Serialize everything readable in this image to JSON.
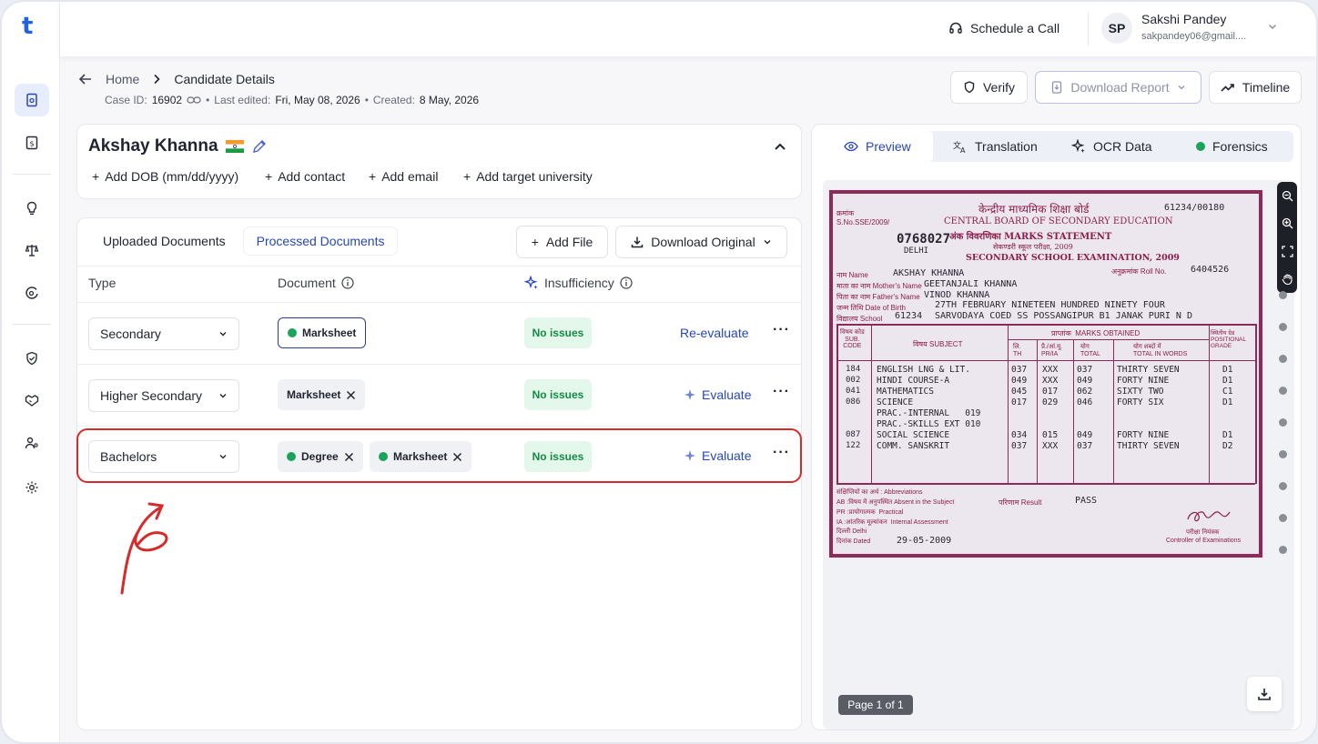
{
  "app": {
    "logo": "t"
  },
  "topbar": {
    "schedule_label": "Schedule a Call",
    "user": {
      "initials": "SP",
      "name": "Sakshi Pandey",
      "email": "sakpandey06@gmail...."
    }
  },
  "breadcrumb": {
    "home": "Home",
    "current": "Candidate Details"
  },
  "meta": {
    "case_label": "Case ID:",
    "case_id": "16902",
    "edited_label": "Last edited:",
    "edited": "Fri, May 08, 2026",
    "created_label": "Created:",
    "created": "8 May, 2026"
  },
  "header_actions": {
    "verify": "Verify",
    "download_report": "Download Report",
    "timeline": "Timeline"
  },
  "candidate": {
    "name": "Akshay Khanna",
    "add_dob": "Add DOB (mm/dd/yyyy)",
    "add_contact": "Add contact",
    "add_email": "Add email",
    "add_university": "Add target university"
  },
  "documents": {
    "tabs": [
      "Uploaded Documents",
      "Processed Documents"
    ],
    "add_file": "Add File",
    "download_original": "Download Original",
    "columns": {
      "type": "Type",
      "document": "Document",
      "insufficiency": "Insufficiency"
    },
    "rows": [
      {
        "type": "Secondary",
        "chips": [
          "Marksheet"
        ],
        "status": "No issues",
        "action": "Re-evaluate"
      },
      {
        "type": "Higher Secondary",
        "chips": [
          "Marksheet"
        ],
        "status": "No issues",
        "action": "Evaluate"
      },
      {
        "type": "Bachelors",
        "chips": [
          "Degree",
          "Marksheet"
        ],
        "status": "No issues",
        "action": "Evaluate"
      }
    ]
  },
  "preview": {
    "tabs": [
      "Preview",
      "Translation",
      "OCR Data",
      "Forensics"
    ],
    "page_indicator": "Page 1 of 1"
  },
  "marksheet": {
    "serial_hi": "क्रमांक",
    "serial": "S.No.SSE/2009/",
    "number": "0768027",
    "city": "DELHI",
    "code": "61234/00180",
    "board_hi": "केन्द्रीय माध्यमिक शिक्षा बोर्ड",
    "board": "CENTRAL BOARD OF SECONDARY EDUCATION",
    "statement_hi": "अंक विवरणिका MARKS STATEMENT",
    "exam_hi": "सेकण्डरी स्कूल परीक्षा, 2009",
    "exam": "SECONDARY SCHOOL EXAMINATION, 2009",
    "roll_label": "अनुक्रमांक Roll No.",
    "roll": "6404526",
    "name_label": "नाम Name",
    "name": "AKSHAY KHANNA",
    "mother_label": "माता का नाम Mother's Name",
    "mother": "GEETANJALI KHANNA",
    "father_label": "पिता का नाम Father's Name",
    "father": "VINOD KHANNA",
    "dob_label": "जन्म तिथि Date of Birth",
    "dob": "27TH FEBRUARY NINETEEN HUNDRED NINETY FOUR",
    "school_label": "विद्यालय School",
    "school_code": "61234",
    "school": "SARVODAYA COED SS POSSANGIPUR B1 JANAK PURI N D",
    "hdr_code": "विषय कोड\nSUB.\nCODE",
    "hdr_subject": "विषय SUBJECT",
    "hdr_marks": "प्राप्तांक  MARKS OBTAINED",
    "hdr_th": "लि.\nTH",
    "hdr_pr": "प्रै./आं.मू.\nPR/IA",
    "hdr_total": "योग\nTOTAL",
    "hdr_words": "योग शब्दों में\nTOTAL IN WORDS",
    "hdr_grade": "स्थितीय ग्रेड\nPOSITIONAL\nGRADE",
    "subjects": [
      {
        "code": "184",
        "name": "ENGLISH LNG & LIT.",
        "th": "037",
        "pr": "XXX",
        "total": "037",
        "words": "THIRTY SEVEN",
        "grade": "D1"
      },
      {
        "code": "002",
        "name": "HINDI COURSE-A",
        "th": "049",
        "pr": "XXX",
        "total": "049",
        "words": "FORTY NINE",
        "grade": "D1"
      },
      {
        "code": "041",
        "name": "MATHEMATICS",
        "th": "045",
        "pr": "017",
        "total": "062",
        "words": "SIXTY TWO",
        "grade": "C1"
      },
      {
        "code": "086",
        "name": "SCIENCE",
        "th": "017",
        "pr": "029",
        "total": "046",
        "words": "FORTY SIX",
        "grade": "D1"
      },
      {
        "code": "",
        "name": "PRAC.-INTERNAL   019",
        "th": "",
        "pr": "",
        "total": "",
        "words": "",
        "grade": ""
      },
      {
        "code": "",
        "name": "PRAC.-SKILLS EXT 010",
        "th": "",
        "pr": "",
        "total": "",
        "words": "",
        "grade": ""
      },
      {
        "code": "087",
        "name": "SOCIAL SCIENCE",
        "th": "034",
        "pr": "015",
        "total": "049",
        "words": "FORTY NINE",
        "grade": "D1"
      },
      {
        "code": "122",
        "name": "COMM. SANSKRIT",
        "th": "037",
        "pr": "XXX",
        "total": "037",
        "words": "THIRTY SEVEN",
        "grade": "D2"
      }
    ],
    "abbr": "संक्षिप्तियों का अर्थ : Abbreviations\nAB :विषय में अनुपस्थित Absent in the Subject\nPR :प्रायोगात्मक  Practical\nIA :आंतरिक मूल्यांकन  Internal Assessment",
    "result_label": "परिणाम Result",
    "result": "PASS",
    "place": "दिल्ली Delhi",
    "dated_label": "दिनांक Dated",
    "dated": "29-05-2009",
    "controller_hi": "परीक्षा नियंत्रक",
    "controller": "Controller of Examinations"
  },
  "colors": {
    "accent": "#2747b8",
    "success": "#1ba35a",
    "highlight": "#d62b2b"
  }
}
